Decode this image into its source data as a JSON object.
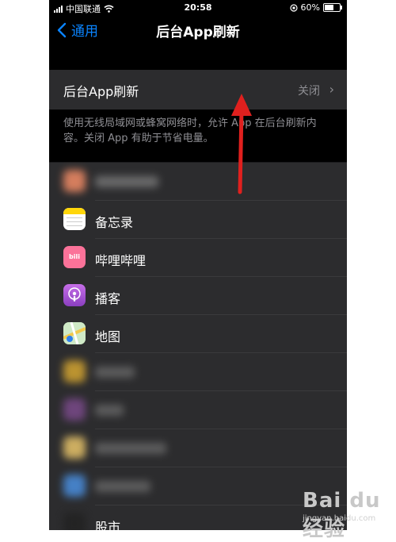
{
  "statusbar": {
    "carrier": "中国联通",
    "time": "20:58",
    "battery": "60%",
    "battery_level": 0.6
  },
  "nav": {
    "back_label": "通用",
    "title": "后台App刷新"
  },
  "setting": {
    "label": "后台App刷新",
    "value": "关闭"
  },
  "description": "使用无线局域网或蜂窝网络时，允许 App 在后台刷新内容。关闭 App 有助于节省电量。",
  "apps": [
    {
      "name": "",
      "icon": "blurred-app-icon",
      "color": "#f28c66",
      "blurred": true
    },
    {
      "name": "备忘录",
      "icon": "notes-icon",
      "color": "#ffd60a",
      "blurred": false
    },
    {
      "name": "哔哩哔哩",
      "icon": "bilibili-icon",
      "color": "#fb7299",
      "blurred": false
    },
    {
      "name": "播客",
      "icon": "podcasts-icon",
      "color": "#9b59d0",
      "blurred": false
    },
    {
      "name": "地图",
      "icon": "maps-icon",
      "color": "#6fc27a",
      "blurred": false
    },
    {
      "name": "",
      "icon": "blurred-app-icon",
      "color": "#d4a531",
      "blurred": true
    },
    {
      "name": "",
      "icon": "blurred-app-icon",
      "color": "#7a4a8a",
      "blurred": true
    },
    {
      "name": "",
      "icon": "blurred-app-icon",
      "color": "#e8c46a",
      "blurred": true
    },
    {
      "name": "",
      "icon": "blurred-app-icon",
      "color": "#4a8fe0",
      "blurred": true
    },
    {
      "name": "股市",
      "icon": "stocks-icon",
      "color": "#222222",
      "blurred": true
    }
  ],
  "watermark": {
    "logo": "Bai du 经验",
    "url": "jingyan.baidu.com"
  },
  "annotation": {
    "arrow_color": "#e0201e"
  }
}
